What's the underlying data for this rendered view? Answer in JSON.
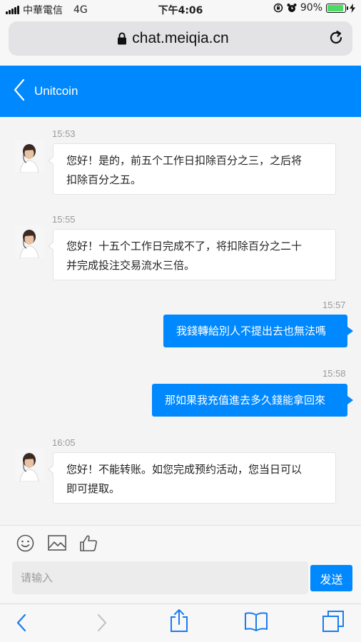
{
  "status_bar": {
    "carrier": "中華電信",
    "network": "4G",
    "time": "下午4:06",
    "battery": "90%",
    "battery_level": 0.9
  },
  "browser": {
    "url": "chat.meiqia.cn"
  },
  "header": {
    "title": "Unitcoin"
  },
  "messages": [
    {
      "time": "15:53",
      "from": "agent",
      "lines": [
        "您好！是的，前五个工作日扣除百分之三，之后将",
        "扣除百分之五。"
      ]
    },
    {
      "time": "15:55",
      "from": "agent",
      "lines": [
        "您好！十五个工作日完成不了，将扣除百分之二十",
        "并完成投注交易流水三倍。"
      ]
    },
    {
      "time": "15:57",
      "from": "user",
      "lines": [
        "我錢轉給別人不提出去也無法嗎"
      ]
    },
    {
      "time": "15:58",
      "from": "user",
      "lines": [
        "那如果我充值進去多久錢能拿回來"
      ]
    },
    {
      "time": "16:05",
      "from": "agent",
      "lines": [
        "您好！不能转账。如您完成预约活动，您当日可以",
        "即可提取。"
      ]
    }
  ],
  "composer": {
    "placeholder": "请输入",
    "send_label": "发送"
  },
  "colors": {
    "accent": "#0088ff",
    "battery": "#4cd964"
  }
}
